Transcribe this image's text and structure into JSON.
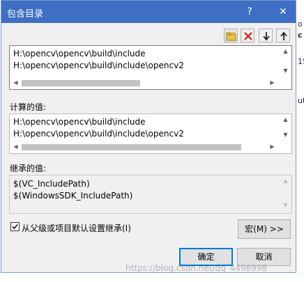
{
  "dialog": {
    "title": "包含目录",
    "help_label": "?",
    "close_label": "✕"
  },
  "toolbar": {
    "new_line": "new-folder-icon",
    "delete": "delete-icon",
    "move_down": "arrow-down-icon",
    "move_up": "arrow-up-icon"
  },
  "editable_list": {
    "lines": [
      "H:\\opencv\\opencv\\build\\include",
      "H:\\opencv\\opencv\\build\\include\\opencv2"
    ]
  },
  "evaluated": {
    "label": "计算的值:",
    "lines": [
      "H:\\opencv\\opencv\\build\\include",
      "H:\\opencv\\opencv\\build\\include\\opencv2"
    ]
  },
  "inherited": {
    "label": "继承的值:",
    "lines": [
      "$(VC_IncludePath)",
      "$(WindowsSDK_IncludePath)"
    ]
  },
  "inherit_checkbox": {
    "label": "从父级或项目默认设置继承(I)",
    "checked": true
  },
  "buttons": {
    "macros": "宏(M) >>",
    "ok": "确定",
    "cancel": "取消"
  },
  "background_fragments": [
    "o",
    "c",
    "15",
    "ut"
  ],
  "watermark": "https://blog.csdn.net/qq_4498998",
  "colors": {
    "titlebar": "#3f6fc4",
    "accent_border": "#0078d7",
    "delete_red": "#d0312d"
  }
}
